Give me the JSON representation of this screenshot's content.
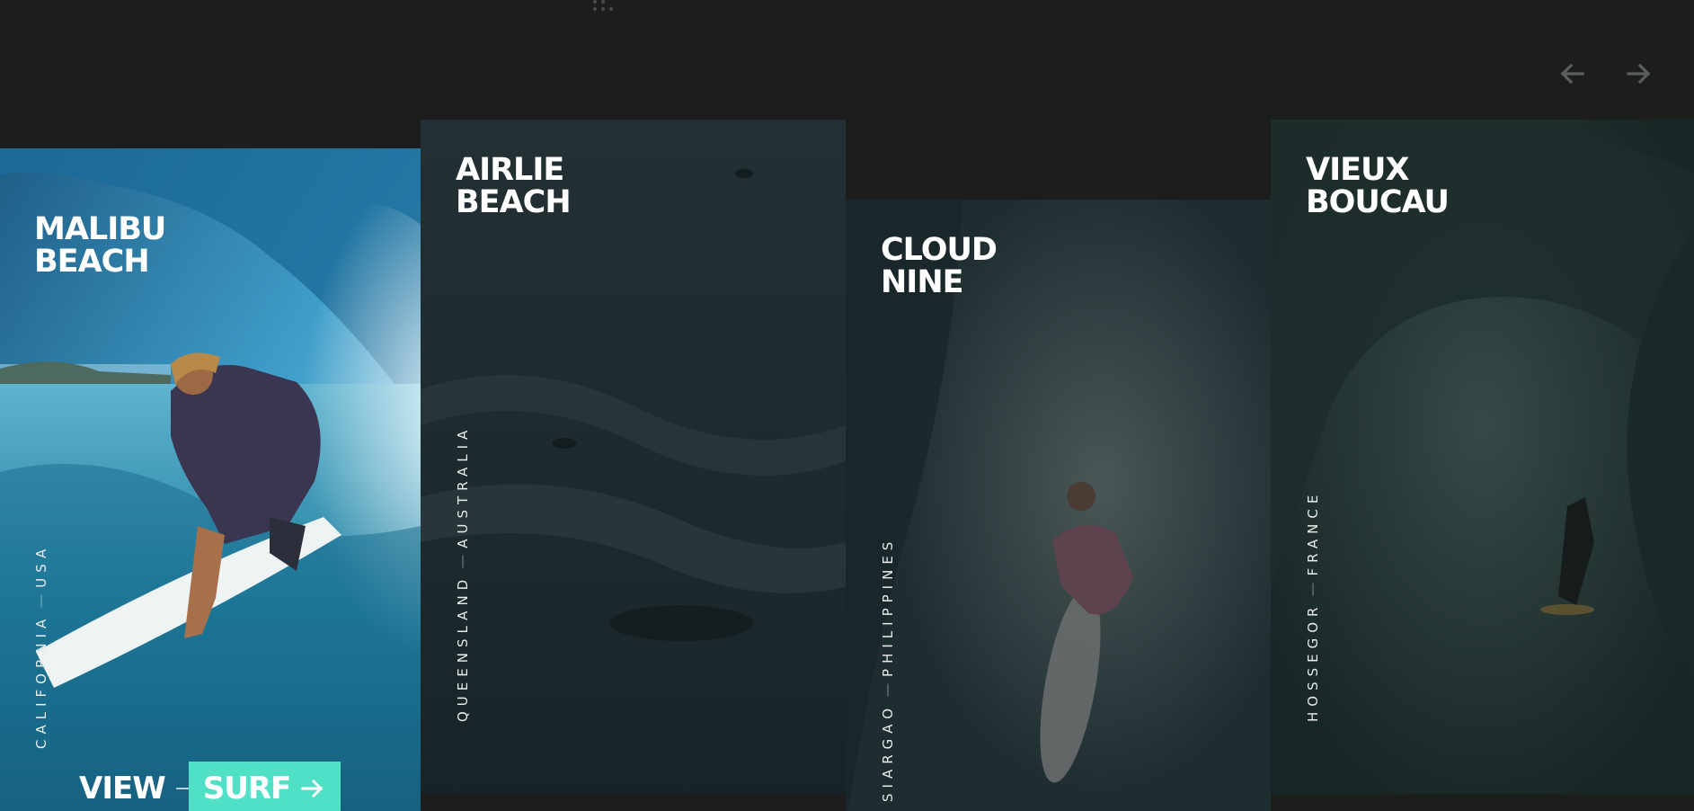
{
  "nav": {
    "prev_icon": "arrow-left-icon",
    "next_icon": "arrow-right-icon",
    "arrow_color": "#5b5e5e",
    "drag_icon": "drag-dots-icon"
  },
  "cards": [
    {
      "title_line1": "MALIBU",
      "title_line2": "BEACH",
      "region": "CALIFORNIA",
      "country": "USA",
      "active": true
    },
    {
      "title_line1": "AIRLIE",
      "title_line2": "BEACH",
      "region": "QUEENSLAND",
      "country": "AUSTRALIA",
      "active": false
    },
    {
      "title_line1": "CLOUD",
      "title_line2": "NINE",
      "region": "SIARGAO",
      "country": "PHILIPPINES",
      "active": false
    },
    {
      "title_line1": "VIEUX",
      "title_line2": "BOUCAU",
      "region": "HOSSEGOR",
      "country": "FRANCE",
      "active": false
    }
  ],
  "cta": {
    "view_label": "VIEW",
    "surf_label": "SURF",
    "arrow_icon": "arrow-right-icon",
    "accent_color": "#4fe0c6"
  },
  "colors": {
    "background": "#1c1d1d"
  }
}
